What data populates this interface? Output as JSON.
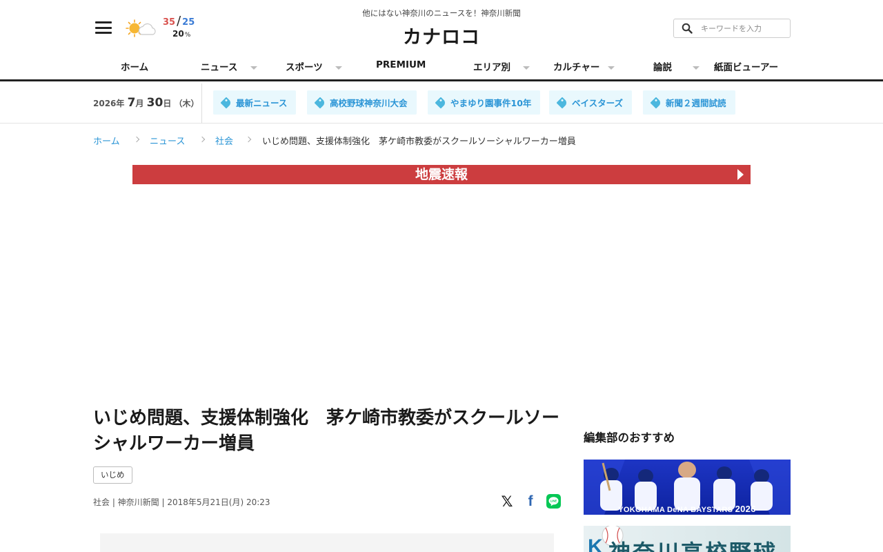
{
  "header": {
    "tagline": "他にはない神奈川のニュースを！神奈川新聞",
    "logo": "カナロコ",
    "weather": {
      "icon": "sun-cloud-icon",
      "high": "35",
      "separator": "/",
      "low": "25",
      "rain_percent": "20",
      "rain_unit": "%"
    },
    "search": {
      "placeholder": "キーワードを入力",
      "icon": "search-icon"
    }
  },
  "nav": {
    "items": [
      {
        "label": "ホーム",
        "has_dropdown": false
      },
      {
        "label": "ニュース",
        "has_dropdown": true
      },
      {
        "label": "スポーツ",
        "has_dropdown": true
      },
      {
        "label": "PREMIUM",
        "has_dropdown": false
      },
      {
        "label": "エリア別",
        "has_dropdown": true
      },
      {
        "label": "カルチャー",
        "has_dropdown": true
      },
      {
        "label": "論説",
        "has_dropdown": true
      },
      {
        "label": "紙面ビューアー",
        "has_dropdown": false
      }
    ]
  },
  "subbar": {
    "date": {
      "year": "2026",
      "year_unit": "年",
      "month": "7",
      "month_unit": "月",
      "day": "30",
      "day_unit": "日",
      "weekday": "（木）"
    },
    "topics": [
      "最新ニュース",
      "高校野球神奈川大会",
      "やまゆり園事件10年",
      "ベイスターズ",
      "新聞２週間試読"
    ]
  },
  "breadcrumb": {
    "links": [
      "ホーム",
      "ニュース",
      "社会"
    ],
    "current": "いじめ問題、支援体制強化　茅ケ崎市教委がスクールソーシャルワーカー増員"
  },
  "quake_banner": {
    "label": "地震速報"
  },
  "article": {
    "title": "いじめ問題、支援体制強化　茅ケ崎市教委がスクールソーシャルワーカー増員",
    "tag": "いじめ",
    "meta": "社会 | 神奈川新聞 | 2018年5月21日(月) 20:23",
    "share": {
      "x": "𝕏",
      "facebook": "f",
      "line": "LINE"
    }
  },
  "sidebar": {
    "title": "編集部のおすすめ",
    "banners": [
      {
        "caption": "YOKOHAMA DeNA BAYSTARS",
        "year": "2026"
      },
      {
        "mark": "K",
        "title": "神奈川高校野球"
      }
    ]
  },
  "colors": {
    "accent_link": "#2b95d6",
    "quake_red": "#cc3d3f",
    "temp_high": "#d9534f",
    "temp_low": "#3a7bd5",
    "topic_bg": "#e9f8fd",
    "baystars_blue": "#1d35c4"
  }
}
